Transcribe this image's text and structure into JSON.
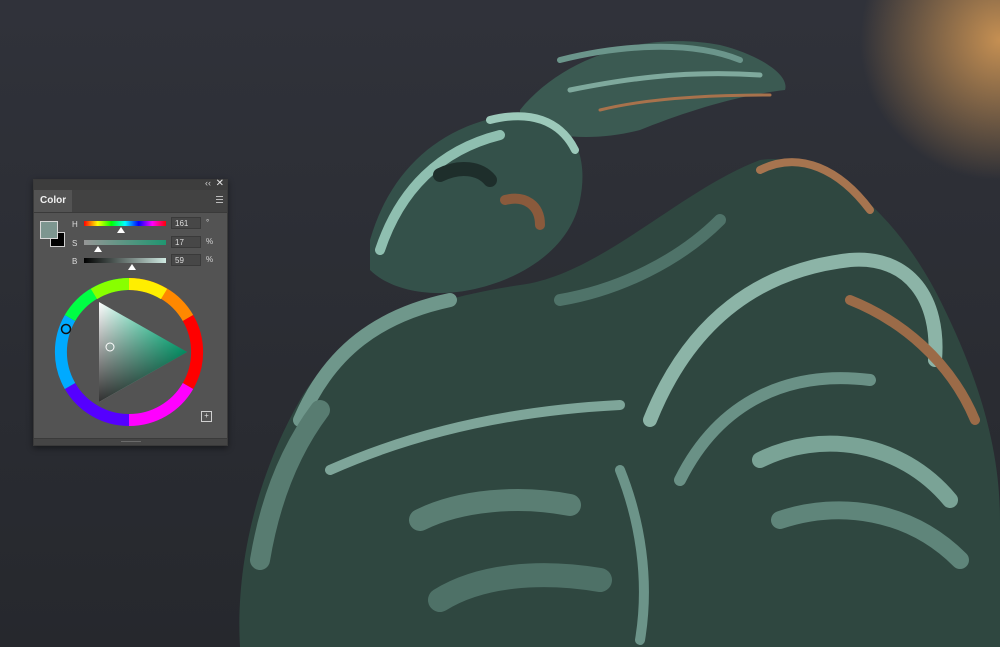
{
  "canvas": {
    "description_icon": "painting-canvas"
  },
  "color_panel": {
    "tab_label": "Color",
    "collapse_glyph": "‹‹",
    "close_glyph": "✕",
    "menu_icon": "panel-menu-icon",
    "foreground_color": "#7d9690",
    "background_color": "#000000",
    "sliders": [
      {
        "label": "H",
        "value": "161",
        "unit": "°",
        "fraction": 0.45
      },
      {
        "label": "S",
        "value": "17",
        "unit": "%",
        "fraction": 0.17
      },
      {
        "label": "B",
        "value": "59",
        "unit": "%",
        "fraction": 0.59
      }
    ],
    "add_icon": "plus-square-icon",
    "add_glyph": "+"
  }
}
